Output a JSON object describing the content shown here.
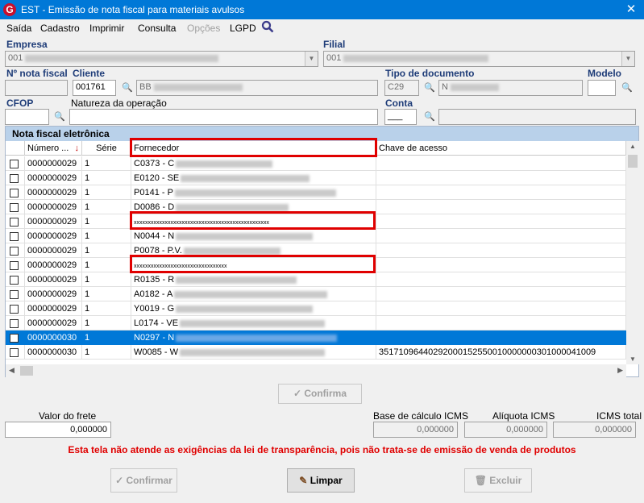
{
  "window": {
    "title": "EST - Emissão de nota fiscal para materiais avulsos",
    "close_glyph": "✕",
    "app_icon_letter": "G"
  },
  "menu": [
    {
      "label": "Saída",
      "disabled": false
    },
    {
      "label": "Cadastro",
      "disabled": false
    },
    {
      "label": "Imprimir",
      "disabled": false
    },
    {
      "label": "Consulta",
      "disabled": false
    },
    {
      "label": "Opções",
      "disabled": true
    },
    {
      "label": "LGPD",
      "disabled": false
    }
  ],
  "form": {
    "empresa_label": "Empresa",
    "empresa_value": "001",
    "filial_label": "Filial",
    "filial_value": "001",
    "nota_fiscal_label": "Nº nota fiscal",
    "nota_fiscal_value": "",
    "cliente_label": "Cliente",
    "cliente_code": "001761",
    "cliente_name": "BB",
    "tipo_documento_label": "Tipo de documento",
    "tipo_documento_code": "C29",
    "tipo_documento_name": "N",
    "modelo_label": "Modelo",
    "modelo_value": "",
    "cfop_label": "CFOP",
    "cfop_value": "",
    "natureza_label": "Natureza da operação",
    "natureza_value": "",
    "conta_label": "Conta",
    "conta_value": "___"
  },
  "grid": {
    "caption": "Nota fiscal eletrônica",
    "columns": [
      "Número ...",
      "Série",
      "Fornecedor",
      "Chave de acesso"
    ],
    "sort_indicator": "↓",
    "rows": [
      {
        "numero": "0000000029",
        "serie": "1",
        "fornecedor": "C0373 - C",
        "chave": "",
        "blur": 120
      },
      {
        "numero": "0000000029",
        "serie": "1",
        "fornecedor": "E0120 - SE",
        "chave": "",
        "blur": 160
      },
      {
        "numero": "0000000029",
        "serie": "1",
        "fornecedor": "P0141 - P",
        "chave": "",
        "blur": 200
      },
      {
        "numero": "0000000029",
        "serie": "1",
        "fornecedor": "D0086 - D",
        "chave": "",
        "blur": 140
      },
      {
        "numero": "0000000029",
        "serie": "1",
        "fornecedor": "xxxxxxxxxxxxxxxxxxxxxxxxxxxxxxxxxxxxxxxxxxxxxxxx",
        "chave": "",
        "blur": 0
      },
      {
        "numero": "0000000029",
        "serie": "1",
        "fornecedor": "N0044 - N",
        "chave": "",
        "blur": 170
      },
      {
        "numero": "0000000029",
        "serie": "1",
        "fornecedor": "P0078 - P.V.",
        "chave": "",
        "blur": 120
      },
      {
        "numero": "0000000029",
        "serie": "1",
        "fornecedor": "xxxxxxxxxxxxxxxxxxxxxxxxxxxxxxxxx",
        "chave": "",
        "blur": 0
      },
      {
        "numero": "0000000029",
        "serie": "1",
        "fornecedor": "R0135 - R",
        "chave": "",
        "blur": 150
      },
      {
        "numero": "0000000029",
        "serie": "1",
        "fornecedor": "A0182 - A",
        "chave": "",
        "blur": 190
      },
      {
        "numero": "0000000029",
        "serie": "1",
        "fornecedor": "Y0019 - G",
        "chave": "",
        "blur": 170
      },
      {
        "numero": "0000000029",
        "serie": "1",
        "fornecedor": "L0174 - VE",
        "chave": "",
        "blur": 180
      },
      {
        "numero": "0000000030",
        "serie": "1",
        "fornecedor": "N0297 - N",
        "chave": "",
        "blur": 200,
        "selected": true
      },
      {
        "numero": "0000000030",
        "serie": "1",
        "fornecedor": "W0085 - W",
        "chave": "35171096440292000152550010000000301000041009",
        "blur": 180
      }
    ]
  },
  "buttons": {
    "confirma_grid": "Confirma",
    "confirmar": "Confirmar",
    "limpar": "Limpar",
    "excluir": "Excluir"
  },
  "totals": {
    "valor_frete_label": "Valor do frete",
    "valor_frete": "0,000000",
    "base_icms_label": "Base de cálculo ICMS",
    "base_icms": "0,000000",
    "aliquota_icms_label": "Alíquota ICMS",
    "aliquota_icms": "0,000000",
    "icms_total_label": "ICMS total",
    "icms_total": "0,000000"
  },
  "warning": "Esta tela não atende as exigências da lei de transparência, pois não trata-se de emissão de venda de produtos",
  "colors": {
    "titlebar": "#0078d7",
    "selection": "#0078d7",
    "highlight_box": "#e00000",
    "caption": "#b9d1ea"
  }
}
